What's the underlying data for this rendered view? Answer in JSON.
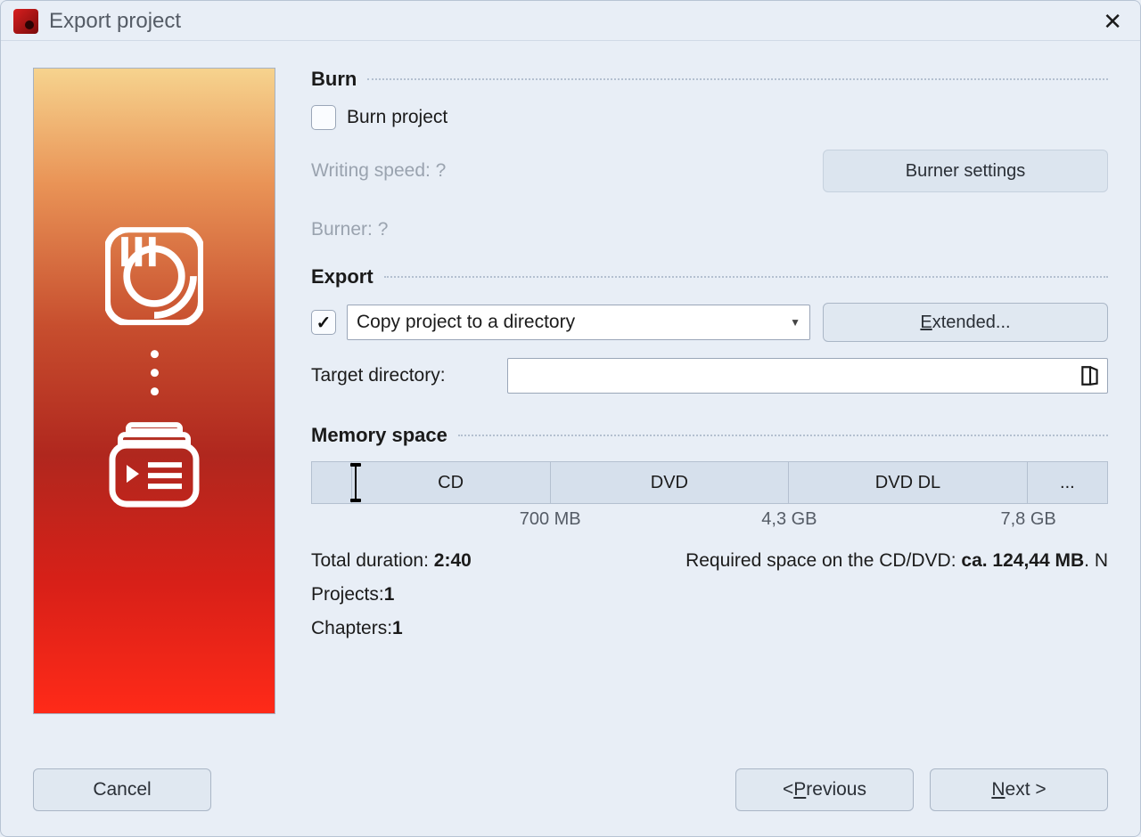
{
  "titlebar": {
    "title": "Export project"
  },
  "burn": {
    "heading": "Burn",
    "burn_project_label": "Burn project",
    "writing_speed_label": "Writing speed: ?",
    "burner_label": "Burner: ?",
    "burner_settings_btn": "Burner settings"
  },
  "export": {
    "heading": "Export",
    "select_value": "Copy project to a directory",
    "extended_btn_prefix": "E",
    "extended_btn_rest": "xtended...",
    "target_dir_label": "Target directory:",
    "target_dir_value": ""
  },
  "memory": {
    "heading": "Memory space",
    "segments": [
      {
        "label": "",
        "width_pct": 5
      },
      {
        "label": "CD",
        "width_pct": 25,
        "tick": "700 MB"
      },
      {
        "label": "DVD",
        "width_pct": 30,
        "tick": "4,3 GB"
      },
      {
        "label": "DVD DL",
        "width_pct": 30,
        "tick": "7,8 GB"
      },
      {
        "label": "...",
        "width_pct": 10
      }
    ]
  },
  "stats": {
    "total_duration_label": "Total duration: ",
    "total_duration_value": "2:40",
    "required_space_label": "Required space on the CD/DVD: ",
    "required_space_value": "ca. 124,44 MB",
    "required_space_suffix": ". N",
    "projects_label": "Projects: ",
    "projects_value": "1",
    "chapters_label": "Chapters: ",
    "chapters_value": "1"
  },
  "footer": {
    "cancel": "Cancel",
    "previous_prefix": "< ",
    "previous_ul": "P",
    "previous_rest": "revious",
    "next_ul": "N",
    "next_rest": "ext >"
  }
}
